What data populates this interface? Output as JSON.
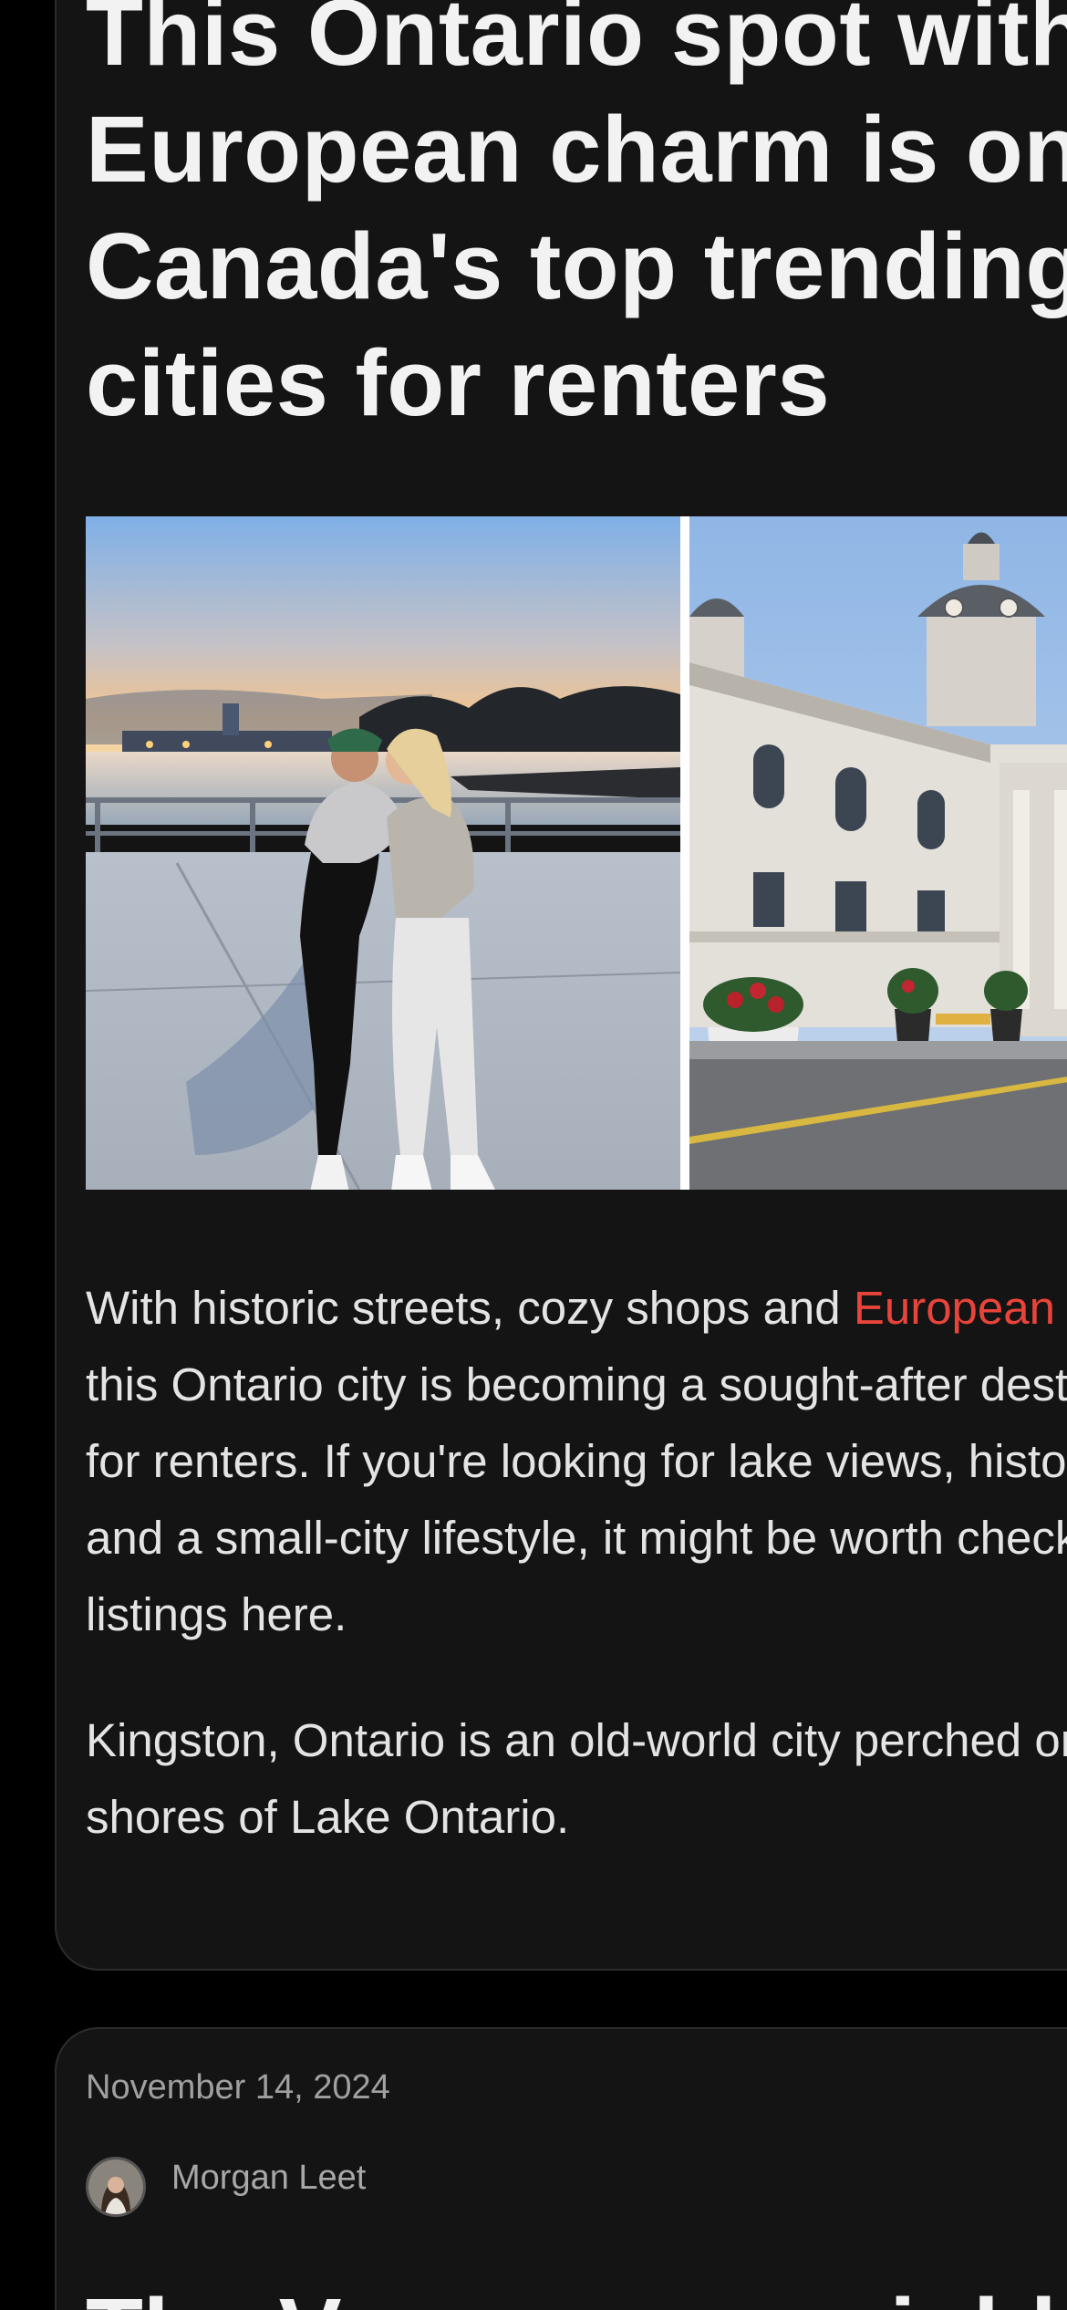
{
  "article": {
    "title": "This Ontario spot with\nEuropean charm is on\nCanada's top trending\ncities for renters",
    "images": [
      {
        "icon": "photo-two-women-waterfront-sunset"
      },
      {
        "icon": "photo-kingston-city-hall"
      }
    ],
    "paragraph_1": {
      "before_link": "With historic streets, cozy shops and ",
      "link_text": "European",
      "after_link": " charm,\nthis Ontario city is becoming a sought-after destination\nfor renters. If you're looking for lake views, history\nand a small-city lifestyle, it might be worth checking\nlistings here."
    },
    "paragraph_2": "Kingston, Ontario is an old-world city perched on the\nshores of Lake Ontario."
  },
  "next_article": {
    "date": "November 14, 2024",
    "author": "Morgan Leet",
    "title_start": "The Vancouver neighbourhood"
  },
  "colors": {
    "background": "#000000",
    "card": "#141414",
    "link": "#e8443a",
    "text": "#f2f2f2"
  }
}
